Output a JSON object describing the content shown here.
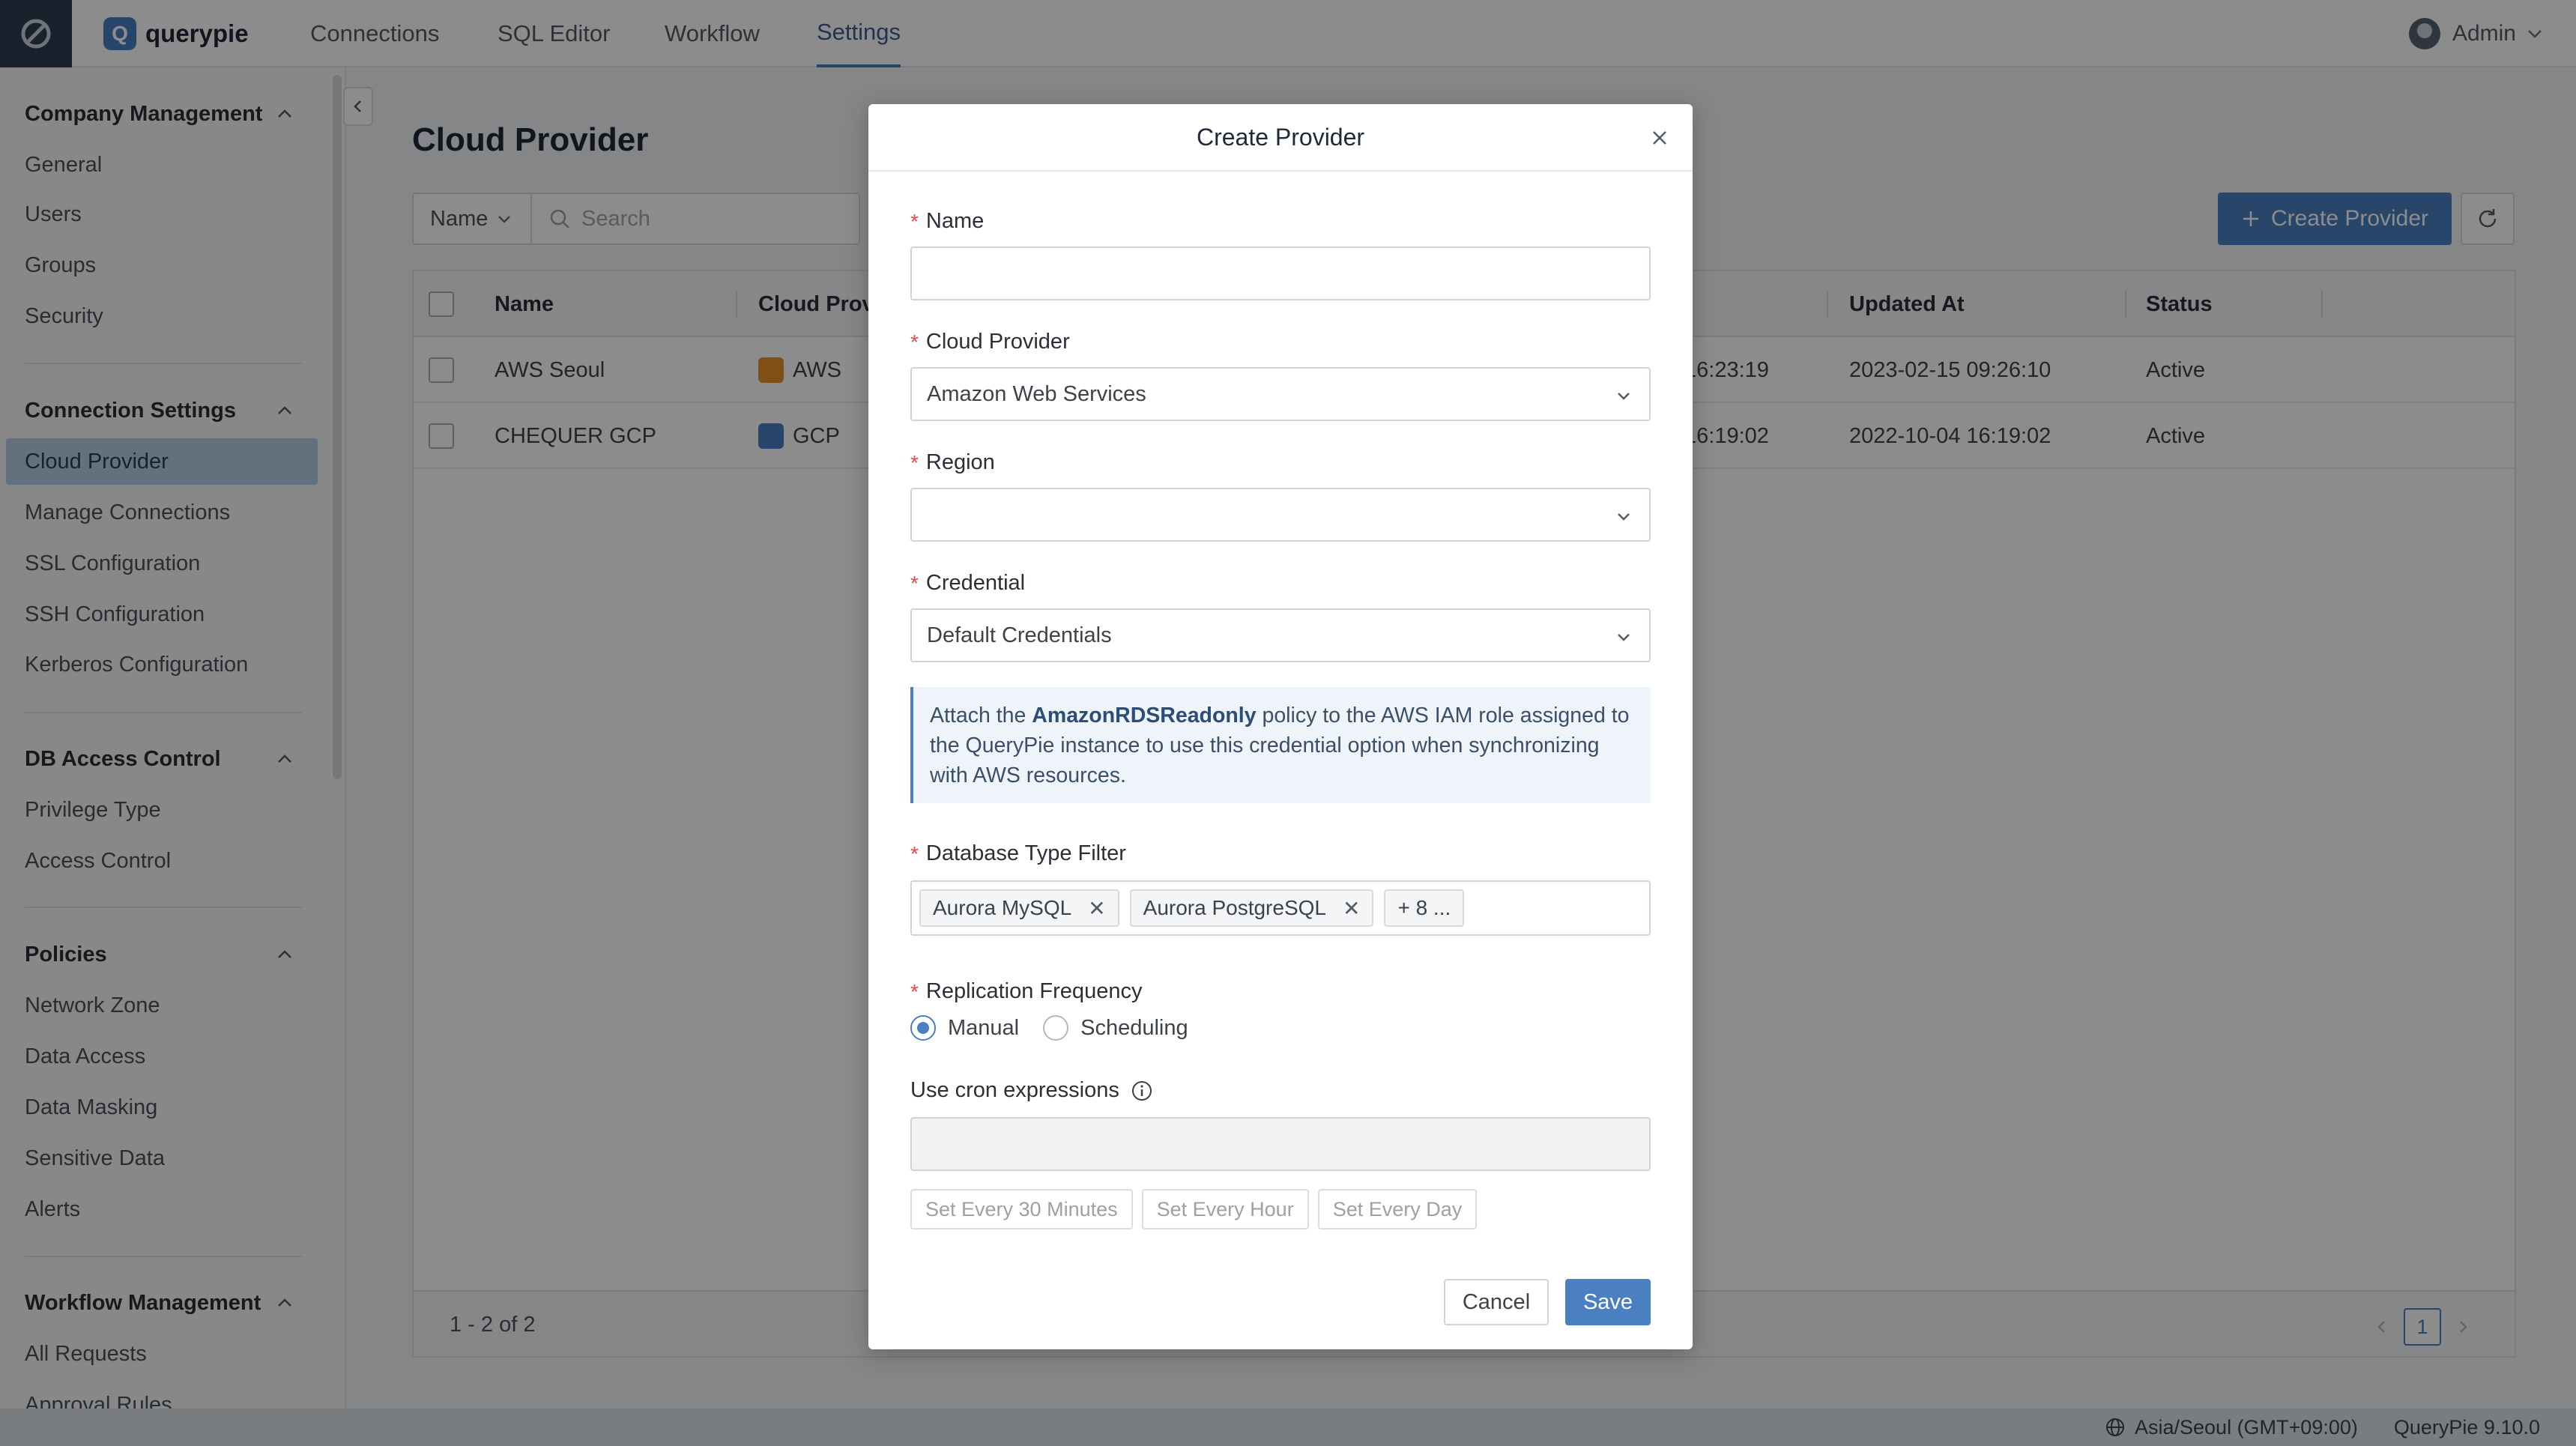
{
  "app": {
    "brand_name": "querypie",
    "brand_letter": "Q",
    "nav_tabs": [
      {
        "label": "Connections"
      },
      {
        "label": "SQL Editor"
      },
      {
        "label": "Workflow"
      },
      {
        "label": "Settings",
        "active": true
      }
    ],
    "user_label": "Admin",
    "accent_color": "#4a7fc1"
  },
  "sidebar": {
    "sections": [
      {
        "title": "Company Management",
        "items": [
          "General",
          "Users",
          "Groups",
          "Security"
        ]
      },
      {
        "title": "Connection Settings",
        "items": [
          "Cloud Provider",
          "Manage Connections",
          "SSL Configuration",
          "SSH Configuration",
          "Kerberos Configuration"
        ],
        "active_item": "Cloud Provider"
      },
      {
        "title": "DB Access Control",
        "items": [
          "Privilege Type",
          "Access Control"
        ]
      },
      {
        "title": "Policies",
        "items": [
          "Network Zone",
          "Data Access",
          "Data Masking",
          "Sensitive Data",
          "Alerts"
        ]
      },
      {
        "title": "Workflow Management",
        "items": [
          "All Requests",
          "Approval Rules"
        ]
      }
    ]
  },
  "page": {
    "title": "Cloud Provider",
    "filter_field": "Name",
    "search_placeholder": "Search",
    "create_button": "Create Provider",
    "table": {
      "columns": [
        "Name",
        "Cloud Prov",
        "",
        "Updated At",
        "Status"
      ],
      "rows": [
        {
          "name": "AWS Seoul",
          "provider": "AWS",
          "created_partial": "16:23:19",
          "updated_at": "2023-02-15 09:26:10",
          "status": "Active"
        },
        {
          "name": "CHEQUER GCP",
          "provider": "GCP",
          "created_partial": "16:19:02",
          "updated_at": "2022-10-04 16:19:02",
          "status": "Active"
        }
      ]
    },
    "pagination": {
      "summary": "1 - 2 of 2",
      "current_page": "1"
    }
  },
  "statusbar": {
    "timezone": "Asia/Seoul (GMT+09:00)",
    "version": "QueryPie 9.10.0"
  },
  "modal": {
    "title": "Create Provider",
    "fields": {
      "name": {
        "label": "Name",
        "value": ""
      },
      "cloud_provider": {
        "label": "Cloud Provider",
        "value": "Amazon Web Services"
      },
      "region": {
        "label": "Region",
        "value": ""
      },
      "credential": {
        "label": "Credential",
        "value": "Default Credentials"
      },
      "database_type_filter": {
        "label": "Database Type Filter",
        "tags": [
          "Aurora MySQL",
          "Aurora PostgreSQL"
        ],
        "more": "+ 8 ..."
      },
      "replication_frequency": {
        "label": "Replication Frequency",
        "options": [
          "Manual",
          "Scheduling"
        ],
        "selected": "Manual"
      },
      "cron": {
        "label": "Use cron expressions",
        "value": "",
        "presets": [
          "Set Every 30 Minutes",
          "Set Every Hour",
          "Set Every Day"
        ]
      }
    },
    "info": {
      "prefix": "Attach the ",
      "policy": "AmazonRDSReadonly",
      "suffix": " policy to the AWS IAM role assigned to the QueryPie instance to use this credential option when synchronizing with AWS resources."
    },
    "cancel_label": "Cancel",
    "save_label": "Save"
  }
}
